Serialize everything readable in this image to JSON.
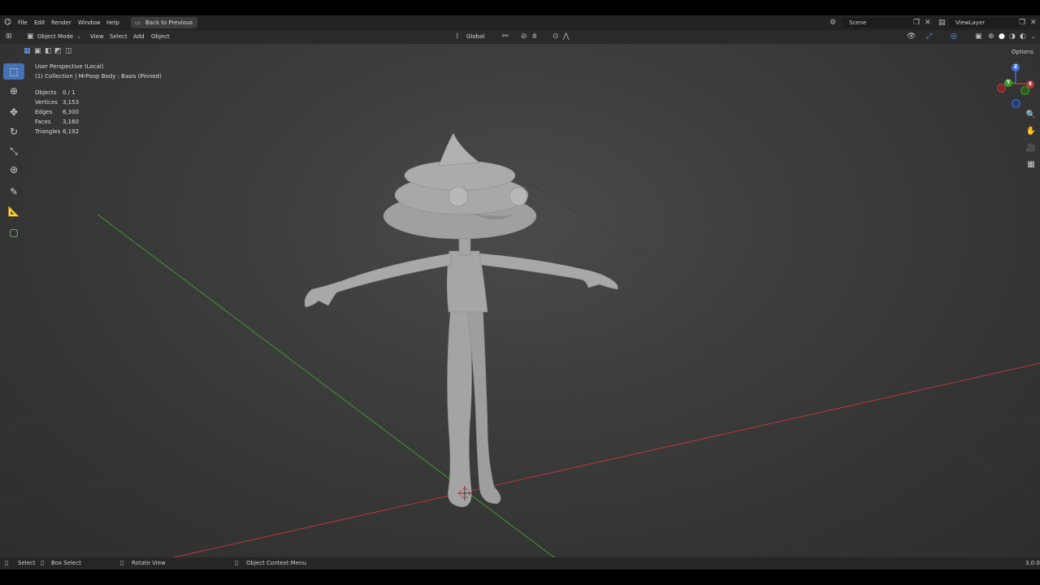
{
  "menubar": {
    "items": [
      "File",
      "Edit",
      "Render",
      "Window",
      "Help"
    ],
    "back_button": "Back to Previous",
    "scene_name": "Scene",
    "view_layer": "ViewLayer"
  },
  "header": {
    "mode": "Object Mode",
    "menus": [
      "View",
      "Select",
      "Add",
      "Object"
    ],
    "transform_orientation": "Global",
    "options_label": "Options"
  },
  "viewport": {
    "perspective": "User Perspective (Local)",
    "collection_info": "(1) Collection | MrPoop Body : Basis (Pinned)",
    "stats": [
      {
        "label": "Objects",
        "value": "0 / 1"
      },
      {
        "label": "Vertices",
        "value": "3,153"
      },
      {
        "label": "Edges",
        "value": "6,300"
      },
      {
        "label": "Faces",
        "value": "3,160"
      },
      {
        "label": "Triangles",
        "value": "6,192"
      }
    ],
    "gizmo_axes": {
      "z": "Z",
      "y": "Y",
      "x": "X"
    }
  },
  "statusbar": {
    "select": "Select",
    "box_select": "Box Select",
    "rotate_view": "Rotate View",
    "context_menu": "Object Context Menu",
    "version": "3.0.0"
  },
  "colors": {
    "accent": "#4772b3",
    "x_axis": "#b5393e",
    "y_axis": "#3f9a2a",
    "z_axis": "#3f6fd8"
  },
  "icons": [
    "blender-logo-icon",
    "editor-type-icon",
    "object-mode-icon",
    "select-box-icon",
    "cursor-icon",
    "move-icon",
    "rotate-icon",
    "scale-icon",
    "transform-icon",
    "annotate-icon",
    "measure-icon",
    "add-cube-icon",
    "zoom-icon",
    "hand-icon",
    "camera-icon",
    "grid-icon"
  ]
}
